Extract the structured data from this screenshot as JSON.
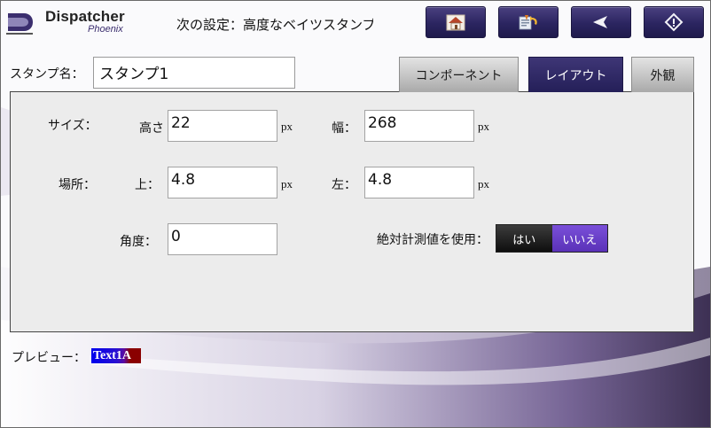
{
  "header": {
    "logo_title": "Dispatcher",
    "logo_subtitle": "Phoenix",
    "next_setting": "次の設定：高度なベイツスタンプ",
    "buttons": [
      {
        "name": "home-button",
        "icon": "home-icon"
      },
      {
        "name": "edit-back-button",
        "icon": "edit-undo-icon"
      },
      {
        "name": "back-button",
        "icon": "back-arrow-icon"
      },
      {
        "name": "start-button",
        "icon": "start-diamond-icon"
      }
    ]
  },
  "stamp": {
    "label": "スタンプ名：",
    "value": "スタンプ1"
  },
  "tabs": [
    {
      "label": "コンポーネント",
      "active": false
    },
    {
      "label": "レイアウト",
      "active": true
    },
    {
      "label": "外観",
      "active": false
    }
  ],
  "panel": {
    "size_label": "サイズ：",
    "height_label": "高さ",
    "height_value": "22",
    "width_label": "幅：",
    "width_value": "268",
    "location_label": "場所：",
    "top_label": "上：",
    "top_value": "4.8",
    "left_label": "左：",
    "left_value": "4.8",
    "angle_label": "角度：",
    "angle_value": "0",
    "unit": "px",
    "absolute_label": "絶対計測値を使用：",
    "toggle_yes": "はい",
    "toggle_no": "いいえ",
    "toggle_selected": "いいえ"
  },
  "preview": {
    "label": "プレビュー：",
    "text": "Text1A"
  },
  "colors": {
    "accent": "#2b2560",
    "toggle_on": "#6a3fcf",
    "panel_bg": "#ececec"
  }
}
